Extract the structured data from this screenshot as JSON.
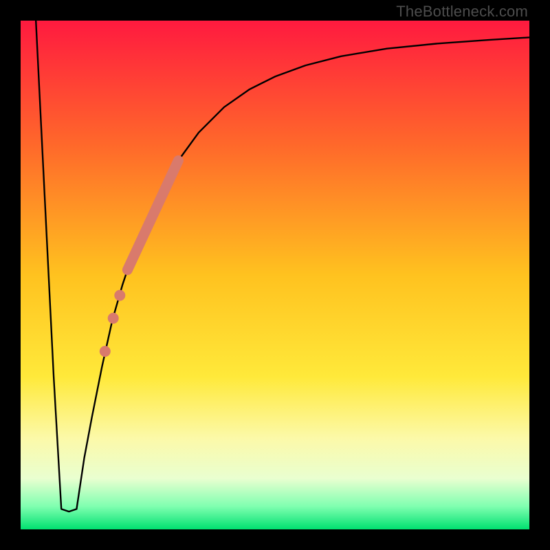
{
  "watermark": "TheBottleneck.com",
  "chart_data": {
    "type": "line",
    "title": "",
    "xlabel": "",
    "ylabel": "",
    "xlim": [
      0,
      100
    ],
    "ylim": [
      0,
      100
    ],
    "grid": false,
    "legend": false,
    "gradient_stops": [
      {
        "offset": 0.0,
        "color": "#ff1a3f"
      },
      {
        "offset": 0.25,
        "color": "#ff6a2a"
      },
      {
        "offset": 0.5,
        "color": "#ffc21f"
      },
      {
        "offset": 0.7,
        "color": "#ffe93a"
      },
      {
        "offset": 0.82,
        "color": "#fcf9a8"
      },
      {
        "offset": 0.9,
        "color": "#e9ffd0"
      },
      {
        "offset": 0.955,
        "color": "#7fffb0"
      },
      {
        "offset": 1.0,
        "color": "#00e070"
      }
    ],
    "series": [
      {
        "name": "bottleneck-curve",
        "stroke": "#000000",
        "stroke_width": 2.4,
        "x": [
          3.0,
          6.5,
          8.0,
          9.5,
          11.0,
          12.5,
          14.0,
          16.0,
          18.0,
          20.0,
          22.0,
          24.0,
          26.0,
          28.0,
          31.0,
          35.0,
          40.0,
          45.0,
          50.0,
          56.0,
          63.0,
          72.0,
          82.0,
          92.0,
          100.0
        ],
        "y": [
          100.0,
          30.0,
          4.0,
          3.5,
          4.0,
          14.0,
          22.0,
          32.0,
          41.0,
          48.0,
          54.0,
          59.0,
          63.5,
          67.5,
          72.5,
          78.0,
          83.0,
          86.5,
          89.0,
          91.2,
          93.0,
          94.5,
          95.5,
          96.2,
          96.7
        ]
      }
    ],
    "highlight_segment": {
      "name": "range-highlight",
      "stroke": "#d97a6c",
      "stroke_width": 15,
      "x": [
        21.0,
        31.0
      ],
      "y": [
        51.0,
        72.5
      ]
    },
    "highlight_dots": {
      "name": "range-dots",
      "fill": "#d97a6c",
      "r": 8,
      "points": [
        {
          "x": 19.5,
          "y": 46.0
        },
        {
          "x": 18.2,
          "y": 41.5
        },
        {
          "x": 16.6,
          "y": 35.0
        }
      ]
    }
  }
}
